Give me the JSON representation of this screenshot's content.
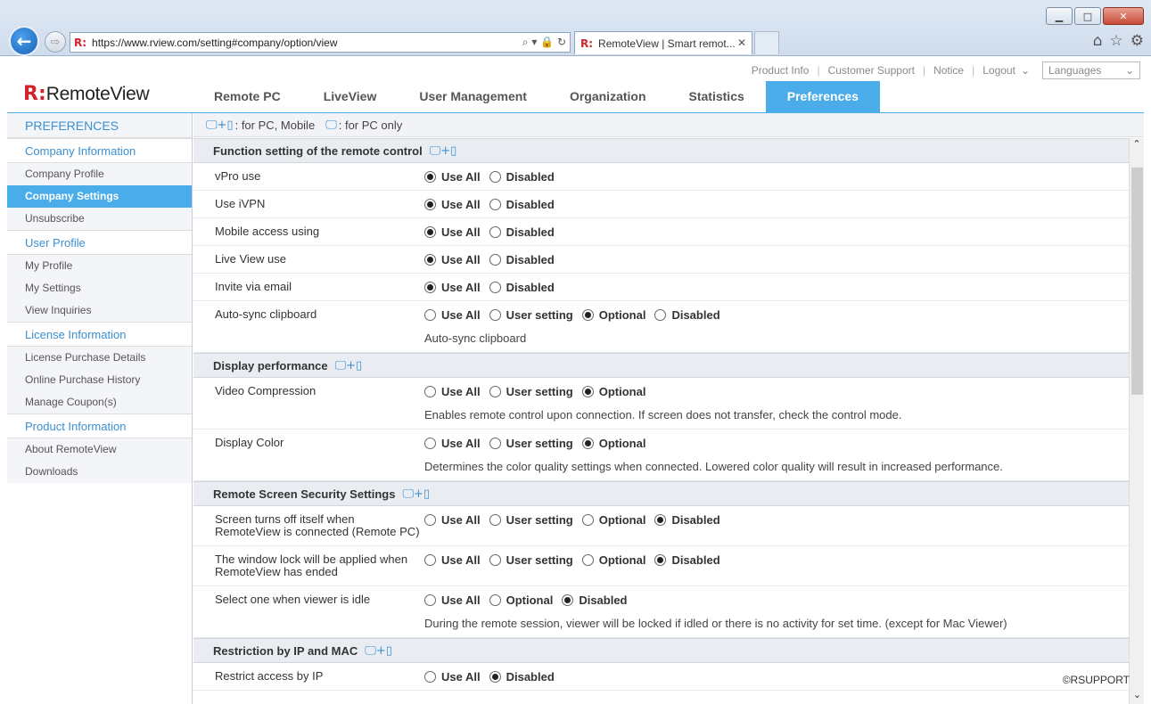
{
  "browser": {
    "url": "https://www.rview.com/setting#company/option/view",
    "tab_title": "RemoteView | Smart remot...",
    "logo_glyph": "R:",
    "back_glyph": "←",
    "forward_glyph": "⇨",
    "minimize_glyph": "▁",
    "maximize_glyph": "□",
    "close_glyph": "✕",
    "tab_close_glyph": "✕",
    "addr_icons": "⌕ ▾ 🔒 ↻",
    "home_glyph": "⌂",
    "favorites_glyph": "☆",
    "tools_glyph": "⚙"
  },
  "topmenu": {
    "product_info": "Product Info",
    "customer_support": "Customer Support",
    "notice": "Notice",
    "logout": "Logout",
    "logout_arrow": "⌄",
    "languages": "Languages",
    "languages_arrow": "⌄",
    "sep": "|"
  },
  "logo": {
    "mark": "R:",
    "text": "RemoteView"
  },
  "nav": [
    "Remote PC",
    "LiveView",
    "User Management",
    "Organization",
    "Statistics",
    "Preferences"
  ],
  "sidebar": {
    "title": "PREFERENCES",
    "groups": [
      {
        "label": "Company Information",
        "items": [
          "Company Profile",
          "Company Settings",
          "Unsubscribe"
        ]
      },
      {
        "label": "User Profile",
        "items": [
          "My Profile",
          "My Settings",
          "View Inquiries"
        ]
      },
      {
        "label": "License Information",
        "items": [
          "License Purchase Details",
          "Online Purchase History",
          "Manage Coupon(s)"
        ]
      },
      {
        "label": "Product Information",
        "items": [
          "About RemoteView",
          "Downloads"
        ]
      }
    ],
    "active_item": "Company Settings"
  },
  "legend": {
    "pc_mobile_icon": "🖵+▯",
    "pc_mobile_text": ": for PC, Mobile",
    "pc_icon": "🖵",
    "pc_text": ": for PC only"
  },
  "sections": [
    {
      "title": "Function setting of the remote control",
      "icon": "🖵+▯",
      "rows": [
        {
          "label": "vPro use",
          "options": [
            "Use All",
            "Disabled"
          ],
          "selected": 0
        },
        {
          "label": "Use iVPN",
          "options": [
            "Use All",
            "Disabled"
          ],
          "selected": 0
        },
        {
          "label": "Mobile access using",
          "options": [
            "Use All",
            "Disabled"
          ],
          "selected": 0
        },
        {
          "label": "Live View use",
          "options": [
            "Use All",
            "Disabled"
          ],
          "selected": 0
        },
        {
          "label": "Invite via email",
          "options": [
            "Use All",
            "Disabled"
          ],
          "selected": 0
        },
        {
          "label": "Auto-sync clipboard",
          "options": [
            "Use All",
            "User setting",
            "Optional",
            "Disabled"
          ],
          "selected": 2,
          "desc": "Auto-sync clipboard"
        }
      ]
    },
    {
      "title": "Display performance",
      "icon": "🖵+▯",
      "rows": [
        {
          "label": "Video Compression",
          "options": [
            "Use All",
            "User setting",
            "Optional"
          ],
          "selected": 2,
          "desc": "Enables remote control upon connection. If screen does not transfer, check the control mode."
        },
        {
          "label": "Display Color",
          "options": [
            "Use All",
            "User setting",
            "Optional"
          ],
          "selected": 2,
          "desc": "Determines the color quality settings when connected. Lowered color quality will result in increased performance."
        }
      ]
    },
    {
      "title": "Remote Screen Security Settings",
      "icon": "🖵+▯",
      "rows": [
        {
          "label": "Screen turns off itself when RemoteView is connected (Remote PC)",
          "options": [
            "Use All",
            "User setting",
            "Optional",
            "Disabled"
          ],
          "selected": 3
        },
        {
          "label": "The window lock will be applied when RemoteView has ended",
          "options": [
            "Use All",
            "User setting",
            "Optional",
            "Disabled"
          ],
          "selected": 3
        },
        {
          "label": "Select one when viewer is idle",
          "options": [
            "Use All",
            "Optional",
            "Disabled"
          ],
          "selected": 2,
          "desc": "During the remote session, viewer will be locked if idled or there is no activity for set time. (except for Mac Viewer)"
        }
      ]
    },
    {
      "title": "Restriction by IP and MAC",
      "icon": "🖵+▯",
      "rows": [
        {
          "label": "Restrict access by IP",
          "options": [
            "Use All",
            "Disabled"
          ],
          "selected": 1
        }
      ]
    }
  ],
  "scrollbar": {
    "up_glyph": "⌃",
    "down_glyph": "⌄",
    "position": 0.0
  },
  "copyright": "©RSUPPORT"
}
